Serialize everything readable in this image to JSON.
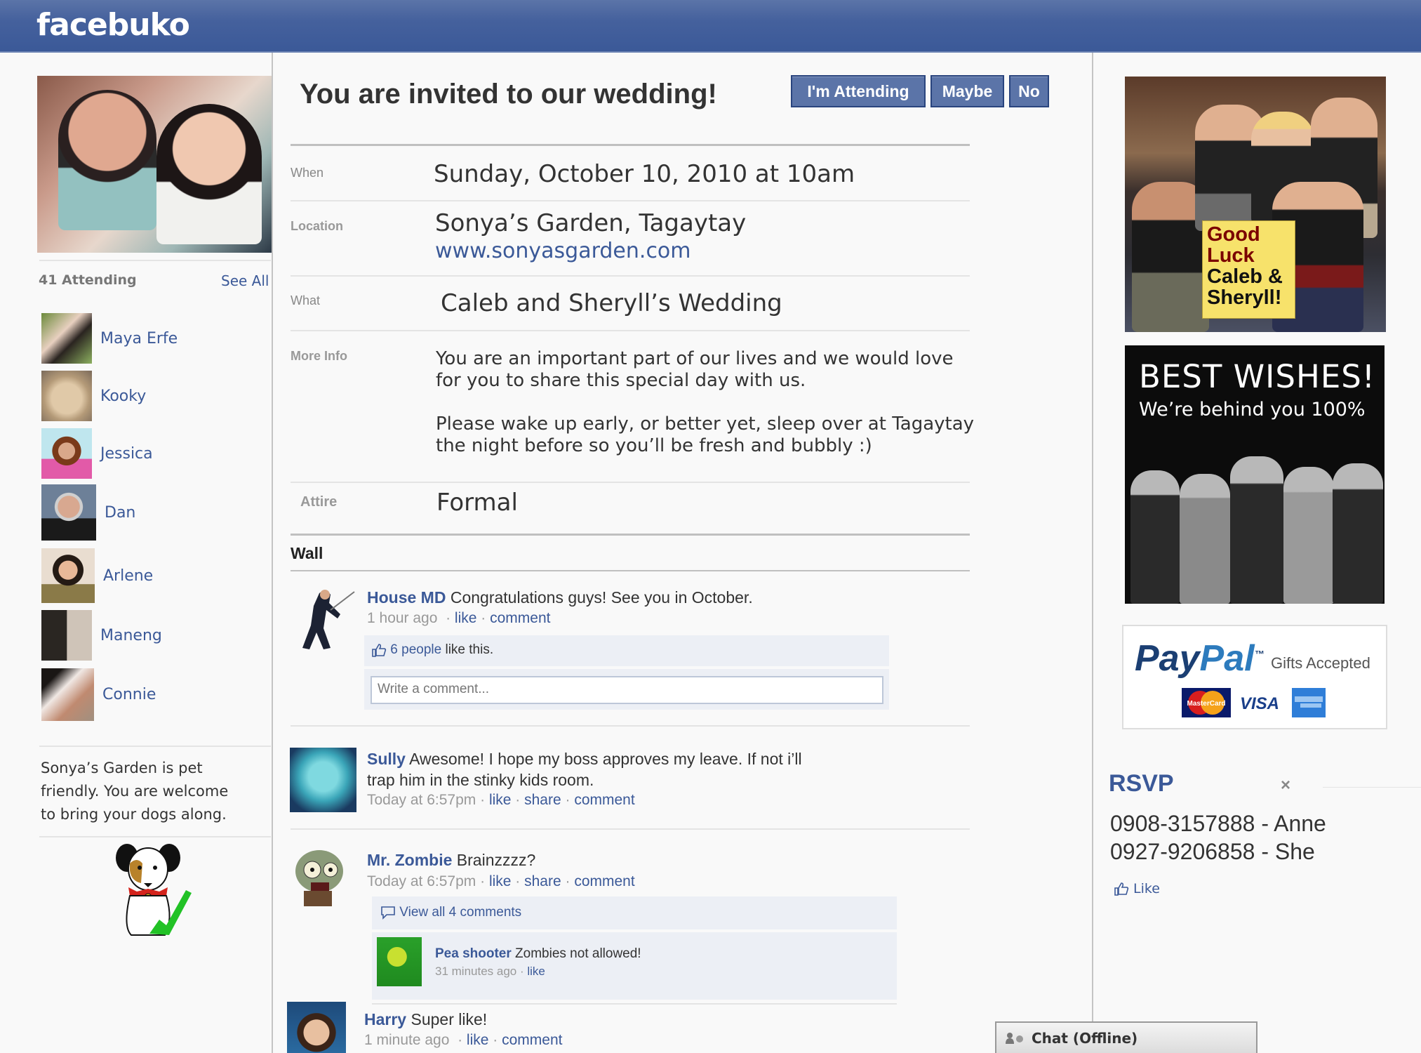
{
  "app": {
    "logo": "facebuko"
  },
  "colors": {
    "brand": "#3b5998",
    "header": "#45619d",
    "link": "#3b5998"
  },
  "event": {
    "title": "You are invited to our wedding!",
    "rsvp_buttons": [
      "I'm Attending",
      "Maybe",
      "No"
    ],
    "details": {
      "when_label": "When",
      "when_value": "Sunday, October 10, 2010 at 10am",
      "location_label": "Location",
      "location_value": "Sonya’s Garden, Tagaytay",
      "location_link": "www.sonyasgarden.com",
      "what_label": "What",
      "what_value": "Caleb and Sheryll’s Wedding",
      "more_info_label": "More Info",
      "more_info_p1_l1": "You are an important part of our lives and we would love",
      "more_info_p1_l2": "for you to share this special day with us.",
      "more_info_p2_l1": "Please wake up early, or better yet, sleep over at Tagaytay",
      "more_info_p2_l2": "the night before so you’ll be fresh and bubbly :)",
      "attire_label": "Attire",
      "attire_value": "Formal"
    }
  },
  "sidebar": {
    "attending_count": "41 Attending",
    "see_all": "See All",
    "guests": [
      {
        "name": "Maya Erfe"
      },
      {
        "name": "Kooky"
      },
      {
        "name": "Jessica"
      },
      {
        "name": "Dan"
      },
      {
        "name": "Arlene"
      },
      {
        "name": "Maneng"
      },
      {
        "name": "Connie"
      }
    ],
    "pet_note_l1": "Sonya’s Garden is pet",
    "pet_note_l2": "friendly. You are welcome",
    "pet_note_l3": "to bring your dogs along.",
    "pet_icon": "dog-with-checkmark-icon"
  },
  "wall": {
    "label": "Wall",
    "posts": [
      {
        "author": "House MD",
        "text": "Congratulations guys! See you in October.",
        "time": "1 hour ago",
        "actions": [
          "like",
          "comment"
        ],
        "likes_text_link": "6 people",
        "likes_text_rest": " like this.",
        "comment_placeholder": "Write a comment..."
      },
      {
        "author": "Sully",
        "text_l1": "Awesome! I hope my boss approves my leave. If not i’ll",
        "text_l2": "trap him in the stinky kids room.",
        "time": "Today at 6:57pm",
        "actions": [
          "like",
          "share",
          "comment"
        ]
      },
      {
        "author": "Mr. Zombie",
        "text": "Brainzzzz?",
        "time": "Today at 6:57pm",
        "actions": [
          "like",
          "share",
          "comment"
        ],
        "view_all": "View all 4 comments",
        "comment": {
          "author": "Pea shooter",
          "text": "Zombies not allowed!",
          "time": "31 minutes ago",
          "actions": [
            "like"
          ]
        }
      },
      {
        "author": "Harry",
        "text": "Super like!",
        "time": "1 minute ago",
        "actions": [
          "like",
          "comment"
        ]
      }
    ]
  },
  "right": {
    "ad1_text": [
      "Good",
      "Luck",
      "Caleb &",
      "Sheryll!"
    ],
    "ad2_title": "BEST WISHES!",
    "ad2_subtitle": "We’re behind you 100%",
    "paypal_logo_a": "Pay",
    "paypal_logo_b": "Pal",
    "paypal_tm": "™",
    "paypal_gifts": "Gifts Accepted",
    "cards": [
      "MasterCard",
      "VISA",
      "American Express"
    ],
    "rsvp_title": "RSVP",
    "rsvp_close": "×",
    "rsvp_lines": [
      "0908-3157888 - Anne",
      "0927-9206858 - She"
    ],
    "like_label": "Like"
  },
  "chat": {
    "label": "Chat (Offline)"
  }
}
